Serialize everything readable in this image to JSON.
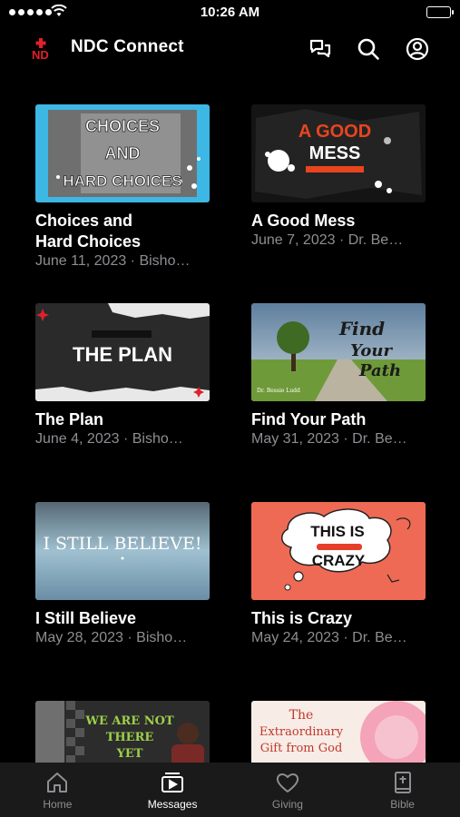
{
  "status_bar": {
    "time": "10:26 AM"
  },
  "header": {
    "logo_text": "ND",
    "title": "NDC Connect",
    "icons": [
      "chat-icon",
      "search-icon",
      "profile-icon"
    ]
  },
  "messages": [
    {
      "title": "Choices and Hard Choices",
      "meta": "June 11, 2023 · Bisho…",
      "thumb": {
        "lines": [
          "CHOICES",
          "AND",
          "HARD CHOICES"
        ]
      }
    },
    {
      "title": "A Good Mess",
      "meta": "June 7, 2023 · Dr. Be…",
      "thumb": {
        "lines": [
          "A GOOD",
          "MESS"
        ]
      }
    },
    {
      "title": "The Plan",
      "meta": "June 4, 2023 · Bisho…",
      "thumb": {
        "lines": [
          "THE PLAN"
        ]
      }
    },
    {
      "title": "Find Your Path",
      "meta": "May 31, 2023 · Dr. Be…",
      "thumb": {
        "lines": [
          "Find",
          "Your",
          "Path"
        ],
        "caption": "Dr. Bessie Ludd"
      }
    },
    {
      "title": "I Still Believe",
      "meta": "May 28, 2023 · Bisho…",
      "thumb": {
        "lines": [
          "I STILL BELIEVE!"
        ]
      }
    },
    {
      "title": "This is Crazy",
      "meta": "May 24, 2023 · Dr. Be…",
      "thumb": {
        "lines": [
          "THIS IS",
          "CRAZY"
        ]
      }
    },
    {
      "title": "",
      "meta": "",
      "thumb": {
        "lines": [
          "WE ARE NOT",
          "THERE",
          "YET"
        ]
      }
    },
    {
      "title": "",
      "meta": "",
      "thumb": {
        "lines": [
          "The",
          "Extraordinary",
          "Gift from God"
        ]
      }
    }
  ],
  "tabs": [
    {
      "label": "Home",
      "icon": "home-icon",
      "active": false
    },
    {
      "label": "Messages",
      "icon": "messages-icon",
      "active": true
    },
    {
      "label": "Giving",
      "icon": "heart-icon",
      "active": false
    },
    {
      "label": "Bible",
      "icon": "bible-icon",
      "active": false
    }
  ],
  "colors": {
    "background": "#000000",
    "tabbar": "#1a1a1a",
    "meta_text": "#8e8e93",
    "logo_red": "#e0202a"
  }
}
